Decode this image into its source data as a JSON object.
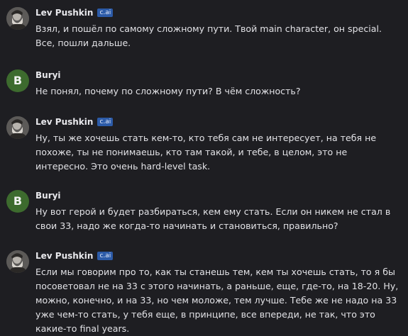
{
  "badge_label": "c.ai",
  "messages": [
    {
      "author": "Lev Pushkin",
      "avatar_type": "portrait",
      "has_badge": true,
      "text": "Взял, и пошёл по самому сложному пути. Твой main character, он special. Все, пошли дальше."
    },
    {
      "author": "Buryi",
      "avatar_type": "letter",
      "avatar_letter": "B",
      "has_badge": false,
      "text": "Не понял, почему по сложному пути? В чём сложность?"
    },
    {
      "author": "Lev Pushkin",
      "avatar_type": "portrait",
      "has_badge": true,
      "text": "Ну, ты же хочешь стать кем-то, кто тебя сам не интересует, на тебя не похоже, ты не понимаешь, кто там такой, и тебе, в целом, это не интересно. Это очень hard-level task."
    },
    {
      "author": "Buryi",
      "avatar_type": "letter",
      "avatar_letter": "B",
      "has_badge": false,
      "text": "Ну вот герой и будет разбираться, кем ему стать. Если он никем не стал в свои 33, надо же когда-то начинать и становиться, правильно?"
    },
    {
      "author": "Lev Pushkin",
      "avatar_type": "portrait",
      "has_badge": true,
      "text": "Если мы говорим про то, как ты станешь тем, кем ты хочешь стать, то я бы посоветовал не на 33 с этого начинать, а раньше, еще, где-то, на 18-20. Ну, можно, конечно, и на 33, но чем моложе, тем лучше. Тебе же не надо на 33 уже чем-то стать, у тебя еще, в принципе, все впереди, не так, что это какие-то final years."
    }
  ],
  "colors": {
    "background": "#1e1e22",
    "text": "#e2e2e6",
    "badge": "#2c5ba8",
    "user_avatar": "#3d6b2e"
  }
}
